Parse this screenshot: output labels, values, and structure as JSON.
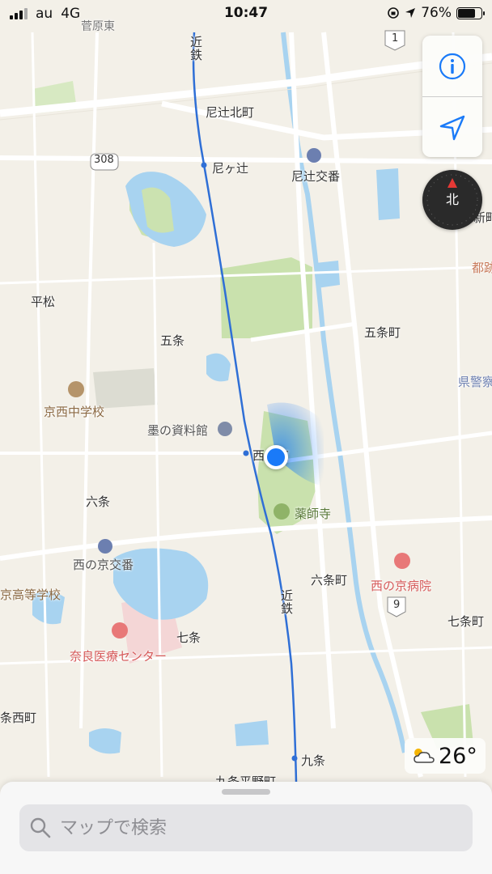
{
  "status_bar": {
    "carrier": "au",
    "network": "4G",
    "time": "10:47",
    "battery": "76%",
    "battery_level": 0.76
  },
  "map": {
    "labels": [
      {
        "id": "amagatsuji-kitamachi",
        "text": "尼辻北町"
      },
      {
        "id": "amagatsuji",
        "text": "尼ヶ辻"
      },
      {
        "id": "amagatsuji-koban",
        "text": "尼辻交番"
      },
      {
        "id": "hiramatsu",
        "text": "平松"
      },
      {
        "id": "gojo",
        "text": "五条"
      },
      {
        "id": "gojo-cho",
        "text": "五条町"
      },
      {
        "id": "prefectural-police",
        "text": "県警察"
      },
      {
        "id": "kyonishi-jhs",
        "text": "京西中学校"
      },
      {
        "id": "sumi-museum",
        "text": "墨の資料館"
      },
      {
        "id": "rokujo",
        "text": "六条"
      },
      {
        "id": "yakushiji",
        "text": "薬師寺"
      },
      {
        "id": "nishinokyo-koban",
        "text": "西の京交番"
      },
      {
        "id": "rokujo-cho",
        "text": "六条町"
      },
      {
        "id": "nishinokyo-hospital",
        "text": "西の京病院"
      },
      {
        "id": "kyo-high-school",
        "text": "京高等学校"
      },
      {
        "id": "shichijo",
        "text": "七条"
      },
      {
        "id": "nara-medical",
        "text": "奈良医療センター"
      },
      {
        "id": "shichijo-cho",
        "text": "七条町"
      },
      {
        "id": "kyujo",
        "text": "九条"
      },
      {
        "id": "kyujo-hiranocho",
        "text": "九条平野町"
      },
      {
        "id": "sujo-nishimachi",
        "text": "条西町"
      },
      {
        "id": "miyako",
        "text": "都跡"
      },
      {
        "id": "shinmachi",
        "text": "新町"
      },
      {
        "id": "nishinokyo-station",
        "text": "西の京"
      },
      {
        "id": "top-cut",
        "text": "菅原東"
      }
    ],
    "rail_label_1": "近鉄",
    "rail_label_2": "近鉄",
    "route_shields": [
      "308",
      "1",
      "9"
    ]
  },
  "controls": {
    "info_icon": "info-icon",
    "location_icon": "location-arrow-icon",
    "compass_label": "北"
  },
  "weather": {
    "icon": "partly-cloudy-icon",
    "temperature": "26°"
  },
  "search": {
    "placeholder": "マップで検索"
  },
  "colors": {
    "accent": "#1a7af8",
    "park": "#c8e0a8",
    "water": "#a9d3f0",
    "rail": "#2f6fd6"
  }
}
